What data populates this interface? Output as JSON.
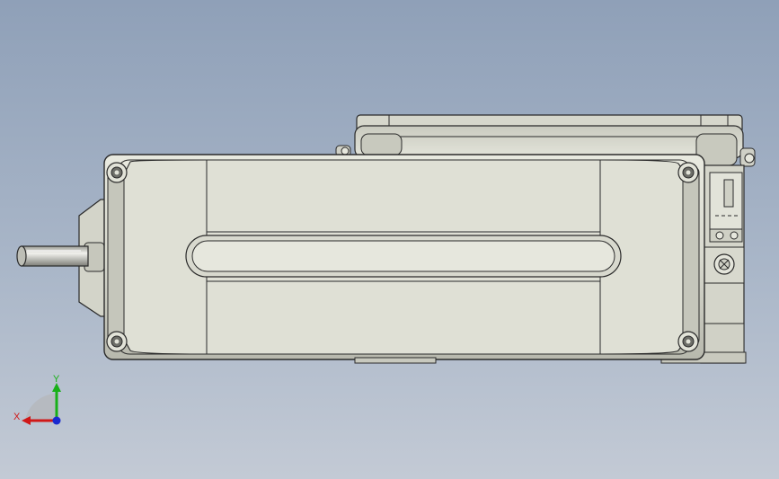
{
  "triad": {
    "x_label": "X",
    "y_label": "Y",
    "x_color": "#d01818",
    "y_color": "#18b018",
    "z_color": "#1a2ad0"
  },
  "model": {
    "body_color": "#dcddd2",
    "edge_color": "#2a2a2a",
    "shade_color": "#b9bab0"
  }
}
